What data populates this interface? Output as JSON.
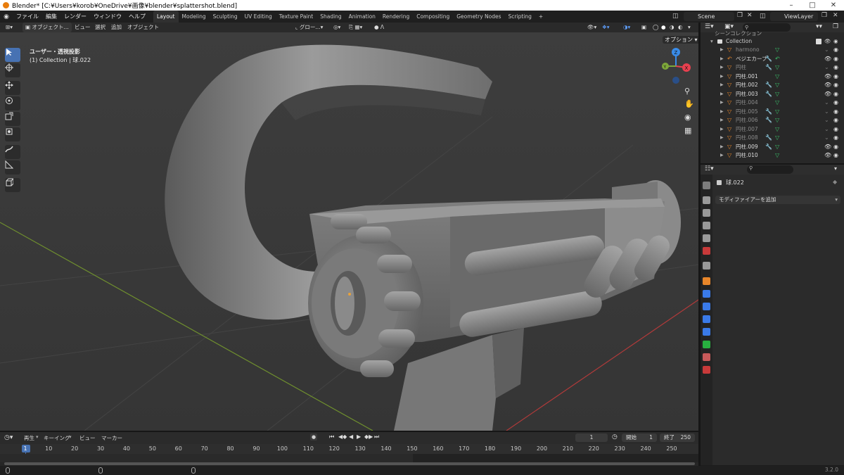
{
  "window": {
    "title": "Blender* [C:¥Users¥korob¥OneDrive¥画像¥blender¥splattershot.blend]"
  },
  "menu": [
    "ファイル",
    "編集",
    "レンダー",
    "ウィンドウ",
    "ヘルプ"
  ],
  "workspaces": [
    "Layout",
    "Modeling",
    "Sculpting",
    "UV Editing",
    "Texture Paint",
    "Shading",
    "Animation",
    "Rendering",
    "Compositing",
    "Geometry Nodes",
    "Scripting"
  ],
  "active_workspace": "Layout",
  "scene": {
    "name": "Scene",
    "view_layer": "ViewLayer"
  },
  "viewport": {
    "mode": "オブジェクト...",
    "menus": [
      "ビュー",
      "選択",
      "追加",
      "オブジェクト"
    ],
    "transform_orientation": "グロー...",
    "options": "オプション",
    "view_name": "ユーザー・透視投影",
    "object_info": "(1) Collection | 球.022",
    "gizmo_axes": {
      "x": "X",
      "y": "Y",
      "z": "Z"
    }
  },
  "outliner": {
    "search_placeholder": "",
    "header_partial": "シーンコレクション",
    "collection": "Collection",
    "items": [
      {
        "name": "harmono",
        "icon": "mesh-icon",
        "dim": true
      },
      {
        "name": "ベジエカーブ",
        "icon": "curve-icon",
        "dim": false
      },
      {
        "name": "円柱",
        "icon": "mesh-icon",
        "dim": true
      },
      {
        "name": "円柱.001",
        "icon": "mesh-icon",
        "dim": false
      },
      {
        "name": "円柱.002",
        "icon": "mesh-icon",
        "dim": false
      },
      {
        "name": "円柱.003",
        "icon": "mesh-icon",
        "dim": false
      },
      {
        "name": "円柱.004",
        "icon": "mesh-icon",
        "dim": true
      },
      {
        "name": "円柱.005",
        "icon": "mesh-icon",
        "dim": true
      },
      {
        "name": "円柱.006",
        "icon": "mesh-icon",
        "dim": true
      },
      {
        "name": "円柱.007",
        "icon": "mesh-icon",
        "dim": true
      },
      {
        "name": "円柱.008",
        "icon": "mesh-icon",
        "dim": true
      },
      {
        "name": "円柱.009",
        "icon": "mesh-icon",
        "dim": false
      },
      {
        "name": "円柱.010",
        "icon": "mesh-icon",
        "dim": false
      }
    ]
  },
  "properties": {
    "object_name": "球.022",
    "add_modifier": "モディファイアーを追加"
  },
  "timeline": {
    "menus": [
      "再生",
      "キーイング",
      "ビュー",
      "マーカー"
    ],
    "current_frame": "1",
    "start_label": "開始",
    "start": "1",
    "end_label": "終了",
    "end": "250",
    "ticks": [
      "1",
      "10",
      "20",
      "30",
      "40",
      "50",
      "60",
      "70",
      "80",
      "90",
      "100",
      "110",
      "120",
      "130",
      "140",
      "150",
      "160",
      "170",
      "180",
      "190",
      "200",
      "210",
      "220",
      "230",
      "240",
      "250"
    ]
  },
  "status": {
    "version": "3.2.0"
  },
  "colors": {
    "accent": "#4772b3",
    "frame": "#4772b3",
    "axis_x": "#e8404f",
    "axis_y": "#7ea83a",
    "axis_z": "#3a8ce8"
  }
}
